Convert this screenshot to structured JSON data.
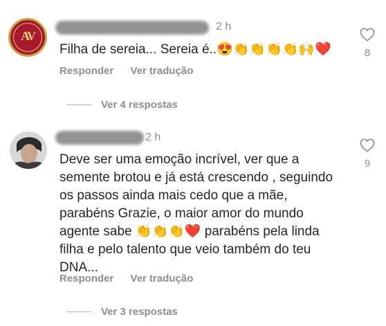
{
  "comments": [
    {
      "time": "2 h",
      "text": "Filha de sereia... Sereia é..😍👏👏👏👏🙌❤️",
      "reply_label": "Responder",
      "translate_label": "Ver tradução",
      "likes": "8",
      "replies_label": "Ver 4 respostas",
      "avatar_monogram": "AV"
    },
    {
      "time": "2 h",
      "text": "Deve ser uma emoção incrível, ver que a\nsemente brotou e já está crescendo , seguindo\nos passos ainda mais cedo que a mãe,\nparabéns Grazie, o maior amor do mundo\nagente sabe 👏👏👏❤️ parabéns pela linda\nfilha e pelo talento que veio também do teu\nDNA...",
      "reply_label": "Responder",
      "translate_label": "Ver tradução",
      "likes": "9",
      "replies_label": "Ver 3 respostas"
    }
  ],
  "icons": {
    "like": "heart-outline-icon"
  },
  "colors": {
    "text": "#262626",
    "muted": "#8e8e8e",
    "avatar_red": "#a6192e",
    "gold": "#c9a449"
  }
}
